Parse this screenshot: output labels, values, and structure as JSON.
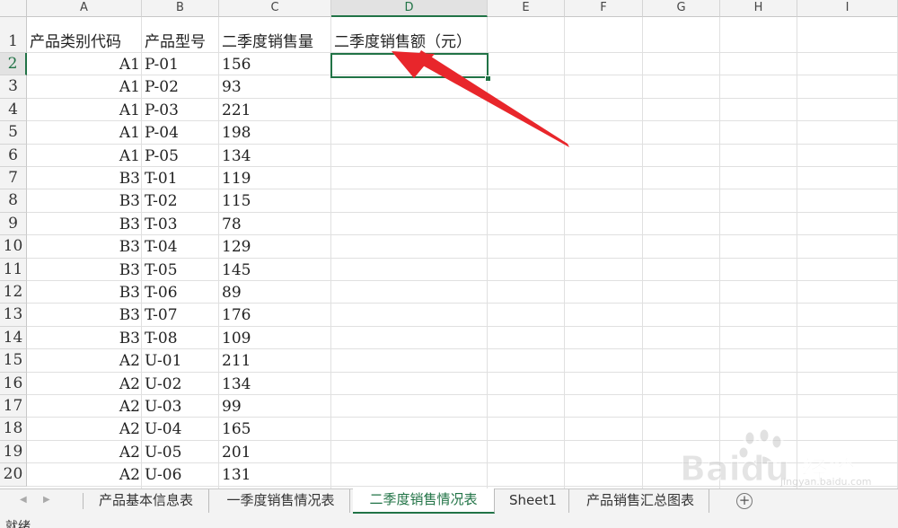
{
  "columns": [
    "A",
    "B",
    "C",
    "D",
    "E",
    "F",
    "G",
    "H",
    "I"
  ],
  "selected_column": "D",
  "rows": [
    {
      "n": "1",
      "a": "产品类别代码",
      "b": "产品型号",
      "c": "二季度销售量",
      "d": "二季度销售额（元）"
    },
    {
      "n": "2",
      "a": "A1",
      "b": "P-01",
      "c": "156",
      "d": ""
    },
    {
      "n": "3",
      "a": "A1",
      "b": "P-02",
      "c": "93",
      "d": ""
    },
    {
      "n": "4",
      "a": "A1",
      "b": "P-03",
      "c": "221",
      "d": ""
    },
    {
      "n": "5",
      "a": "A1",
      "b": "P-04",
      "c": "198",
      "d": ""
    },
    {
      "n": "6",
      "a": "A1",
      "b": "P-05",
      "c": "134",
      "d": ""
    },
    {
      "n": "7",
      "a": "B3",
      "b": "T-01",
      "c": "119",
      "d": ""
    },
    {
      "n": "8",
      "a": "B3",
      "b": "T-02",
      "c": "115",
      "d": ""
    },
    {
      "n": "9",
      "a": "B3",
      "b": "T-03",
      "c": "78",
      "d": ""
    },
    {
      "n": "10",
      "a": "B3",
      "b": "T-04",
      "c": "129",
      "d": ""
    },
    {
      "n": "11",
      "a": "B3",
      "b": "T-05",
      "c": "145",
      "d": ""
    },
    {
      "n": "12",
      "a": "B3",
      "b": "T-06",
      "c": "89",
      "d": ""
    },
    {
      "n": "13",
      "a": "B3",
      "b": "T-07",
      "c": "176",
      "d": ""
    },
    {
      "n": "14",
      "a": "B3",
      "b": "T-08",
      "c": "109",
      "d": ""
    },
    {
      "n": "15",
      "a": "A2",
      "b": "U-01",
      "c": "211",
      "d": ""
    },
    {
      "n": "16",
      "a": "A2",
      "b": "U-02",
      "c": "134",
      "d": ""
    },
    {
      "n": "17",
      "a": "A2",
      "b": "U-03",
      "c": "99",
      "d": ""
    },
    {
      "n": "18",
      "a": "A2",
      "b": "U-04",
      "c": "165",
      "d": ""
    },
    {
      "n": "19",
      "a": "A2",
      "b": "U-05",
      "c": "201",
      "d": ""
    },
    {
      "n": "20",
      "a": "A2",
      "b": "U-06",
      "c": "131",
      "d": ""
    }
  ],
  "active_cell": "D2",
  "sheet_tabs": [
    {
      "label": "产品基本信息表",
      "active": false
    },
    {
      "label": "一季度销售情况表",
      "active": false
    },
    {
      "label": "二季度销售情况表",
      "active": true
    },
    {
      "label": "Sheet1",
      "active": false
    },
    {
      "label": "产品销售汇总图表",
      "active": false
    }
  ],
  "nav": {
    "prev_icon": "tri-left-icon",
    "next_icon": "tri-right-icon"
  },
  "add_sheet_icon": "plus-circle-icon",
  "status": {
    "text": "就绪"
  },
  "watermark": {
    "brand": "Baidu",
    "sub": "经验",
    "url": "jingyan.baidu.com"
  },
  "annotation": {
    "icon": "red-arrow-icon",
    "color": "#e8262b"
  },
  "colors": {
    "accent": "#217346",
    "header_bg": "#f3f3f3",
    "grid": "#e0e0e0"
  }
}
